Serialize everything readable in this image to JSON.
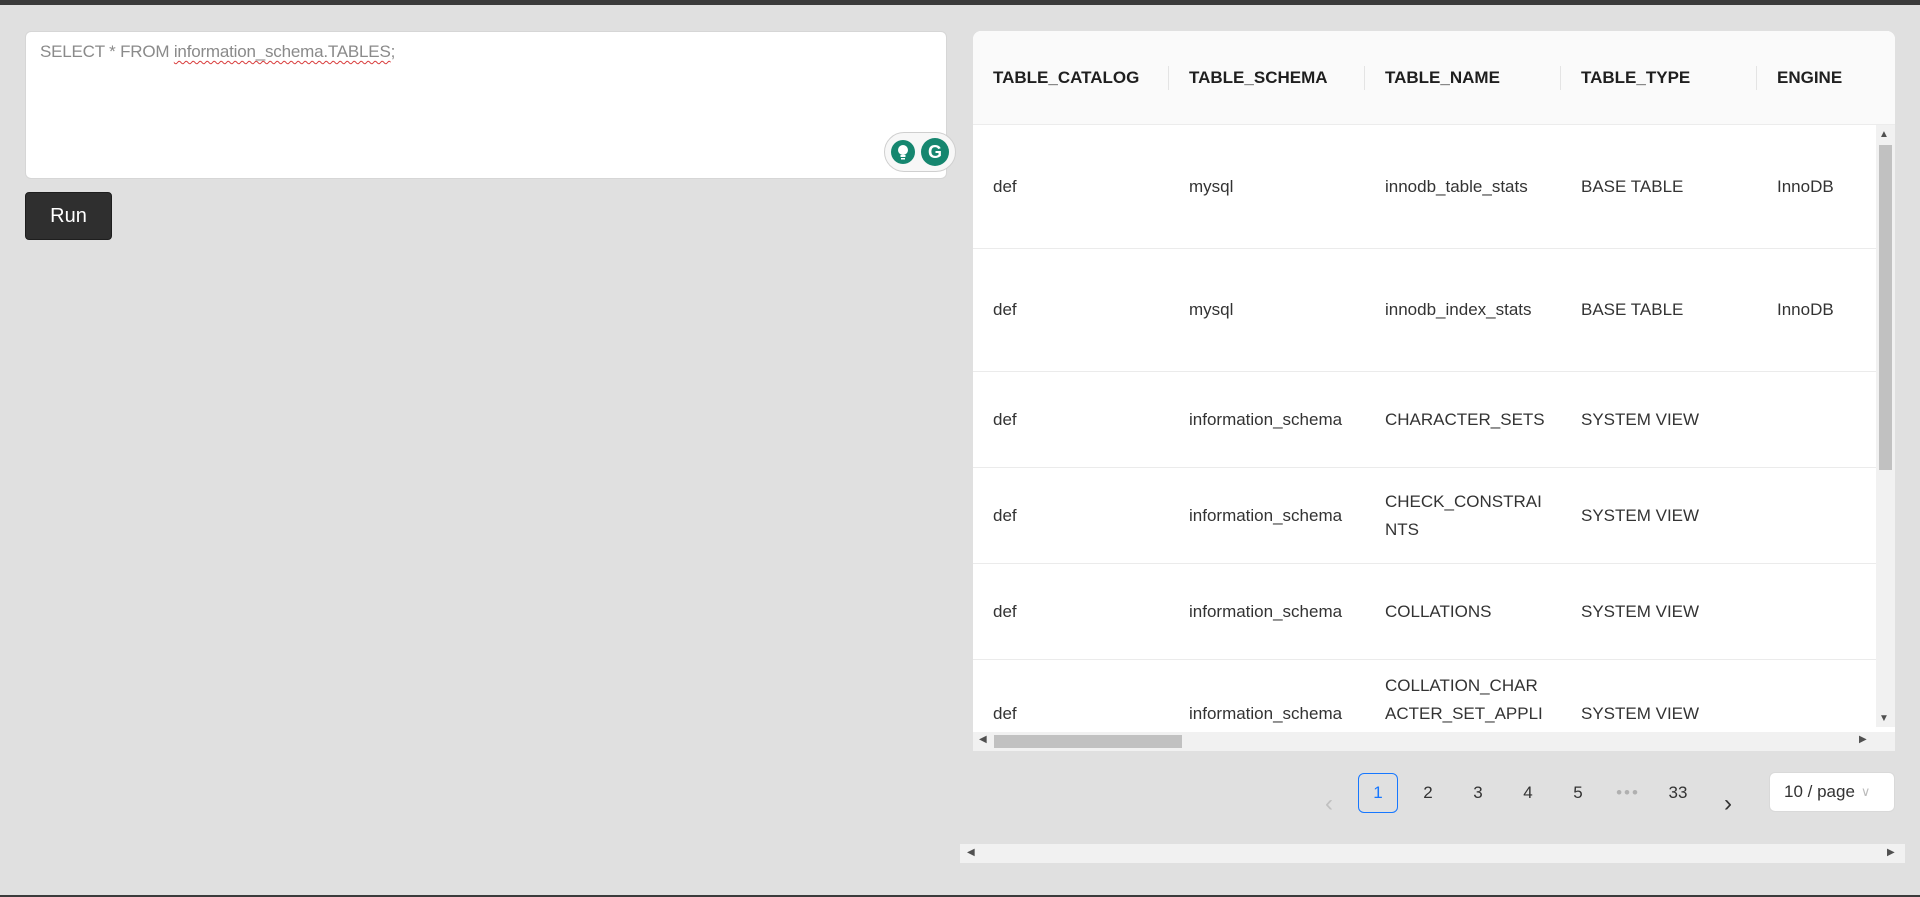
{
  "editor": {
    "query_prefix": "SELECT * FROM ",
    "query_table": "information_schema.TABLES",
    "query_suffix": ";",
    "assist_g": "G"
  },
  "run_button": {
    "label": "Run"
  },
  "table": {
    "columns": [
      "TABLE_CATALOG",
      "TABLE_SCHEMA",
      "TABLE_NAME",
      "TABLE_TYPE",
      "ENGINE"
    ],
    "rows": [
      [
        "def",
        "mysql",
        "innodb_table_stats",
        "BASE TABLE",
        "InnoDB"
      ],
      [
        "def",
        "mysql",
        "innodb_index_stats",
        "BASE TABLE",
        "InnoDB"
      ],
      [
        "def",
        "information_schema",
        "CHARACTER_SETS",
        "SYSTEM VIEW",
        ""
      ],
      [
        "def",
        "information_schema",
        "CHECK_CONSTRAINTS",
        "SYSTEM VIEW",
        ""
      ],
      [
        "def",
        "information_schema",
        "COLLATIONS",
        "SYSTEM VIEW",
        ""
      ],
      [
        "def",
        "information_schema",
        "COLLATION_CHARACTER_SET_APPLICABILITY",
        "SYSTEM VIEW",
        ""
      ]
    ]
  },
  "pagination": {
    "prev": "‹",
    "pages": [
      "1",
      "2",
      "3",
      "4",
      "5"
    ],
    "ellipsis": "•••",
    "last": "33",
    "next": "›",
    "current": "1",
    "page_size": "10 / page"
  },
  "icons": {
    "bulb": "lightbulb-icon",
    "grammar": "grammarly-icon",
    "chevron": "chevron-down-icon"
  }
}
